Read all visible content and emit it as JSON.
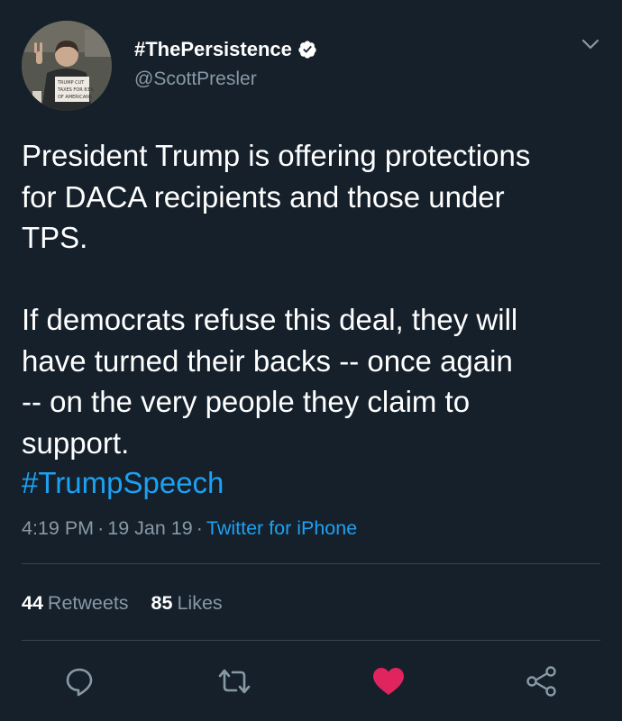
{
  "tweet": {
    "display_name": "#ThePersistence",
    "handle": "@ScottPresler",
    "text": "President Trump is offering protections\nfor DACA recipients and those under\nTPS.\n\nIf democrats refuse this deal, they will\nhave turned their backs -- once again\n-- on the very people they claim to\nsupport.",
    "hashtag": "#TrumpSpeech",
    "time": "4:19 PM",
    "date": "19 Jan 19",
    "source": "Twitter for iPhone",
    "separator": "·"
  },
  "avatar": {
    "sign_lines": [
      "TRUMP CUT",
      "TAXES FOR 83%",
      "OF AMERICANS"
    ]
  },
  "stats": {
    "retweets_count": "44",
    "retweets_label": "Retweets",
    "likes_count": "85",
    "likes_label": "Likes"
  },
  "actions": {
    "reply_icon": "reply-icon",
    "retweet_icon": "retweet-icon",
    "like_icon": "heart-icon",
    "share_icon": "share-icon"
  },
  "colors": {
    "background": "#15202b",
    "text": "#ffffff",
    "secondary": "#8899a6",
    "link": "#1da1f2",
    "like": "#e0245e",
    "divider": "#38444d"
  }
}
